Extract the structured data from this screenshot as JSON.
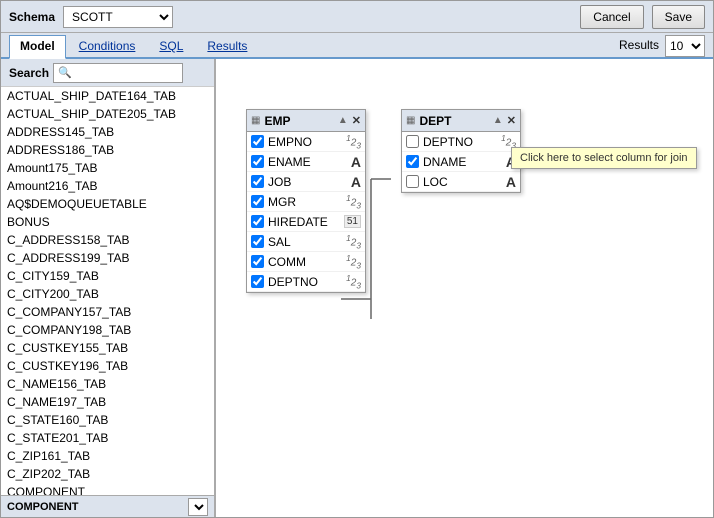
{
  "header": {
    "schema_label": "Schema",
    "schema_value": "SCOTT",
    "cancel_label": "Cancel",
    "save_label": "Save"
  },
  "nav": {
    "tabs": [
      {
        "id": "model",
        "label": "Model",
        "active": true
      },
      {
        "id": "conditions",
        "label": "Conditions",
        "active": false
      },
      {
        "id": "sql",
        "label": "SQL",
        "active": false
      },
      {
        "id": "results",
        "label": "Results",
        "active": false
      }
    ],
    "results_count": "10"
  },
  "search": {
    "label": "Search",
    "placeholder": ""
  },
  "table_list": {
    "items": [
      "ACTUAL_SHIP_DATE164_TAB",
      "ACTUAL_SHIP_DATE205_TAB",
      "ADDRESS145_TAB",
      "ADDRESS186_TAB",
      "Amount175_TAB",
      "Amount216_TAB",
      "AQ$DEMOQUEUETABLE",
      "BONUS",
      "C_ADDRESS158_TAB",
      "C_ADDRESS199_TAB",
      "C_CITY159_TAB",
      "C_CITY200_TAB",
      "C_COMPANY157_TAB",
      "C_COMPANY198_TAB",
      "C_CUSTKEY155_TAB",
      "C_CUSTKEY196_TAB",
      "C_NAME156_TAB",
      "C_NAME197_TAB",
      "C_STATE160_TAB",
      "C_STATE201_TAB",
      "C_ZIP161_TAB",
      "C_ZIP202_TAB",
      "COMPONENT"
    ],
    "footer_label": "COMPONENT"
  },
  "emp_table": {
    "title": "EMP",
    "rows": [
      {
        "name": "EMPNO",
        "type": "num",
        "checked": true
      },
      {
        "name": "ENAME",
        "type": "A",
        "checked": true
      },
      {
        "name": "JOB",
        "type": "A",
        "checked": true
      },
      {
        "name": "MGR",
        "type": "num",
        "checked": true
      },
      {
        "name": "HIREDATE",
        "type": "date",
        "checked": true
      },
      {
        "name": "SAL",
        "type": "num",
        "checked": true
      },
      {
        "name": "COMM",
        "type": "num",
        "checked": true
      },
      {
        "name": "DEPTNO",
        "type": "num",
        "checked": true
      }
    ]
  },
  "dept_table": {
    "title": "DEPT",
    "rows": [
      {
        "name": "DEPTNO",
        "type": "num",
        "checked": false
      },
      {
        "name": "DNAME",
        "type": "A",
        "checked": true
      },
      {
        "name": "LOC",
        "type": "A",
        "checked": false
      }
    ]
  },
  "tooltip": {
    "text": "Click here to select column for join"
  },
  "icons": {
    "search": "🔍",
    "table": "▦",
    "sort_asc": "▲",
    "close": "✕"
  }
}
